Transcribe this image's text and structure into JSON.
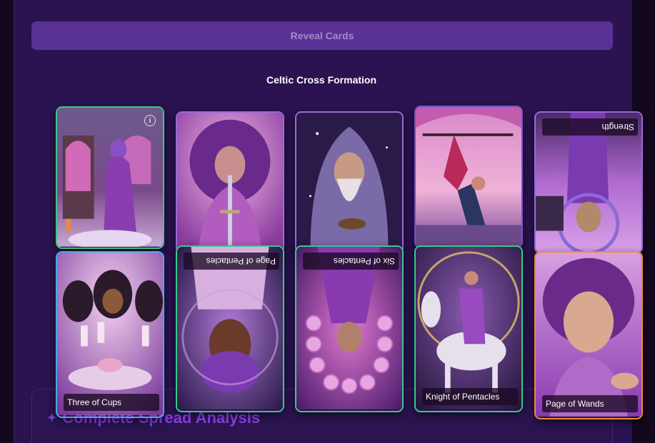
{
  "header": {
    "reveal_label": "Reveal Cards"
  },
  "formation": {
    "title": "Celtic Cross Formation"
  },
  "analysis": {
    "title": "Complete Spread Analysis"
  },
  "cards": [
    {
      "name": "",
      "reversed": false,
      "border": "#38c98a"
    },
    {
      "name": "",
      "reversed": false,
      "border": "#9b6ad6"
    },
    {
      "name": "",
      "reversed": false,
      "border": "#9b6ad6"
    },
    {
      "name": "",
      "reversed": false,
      "border": "#7a4fc2"
    },
    {
      "name": "Strength",
      "reversed": true,
      "border": "#9b6ad6"
    },
    {
      "name": "Three of Cups",
      "reversed": false,
      "border": "#4aa7e8"
    },
    {
      "name": "Page of Pentacles",
      "reversed": true,
      "border": "#38c98a"
    },
    {
      "name": "Six of Pentacles",
      "reversed": true,
      "border": "#38c98a"
    },
    {
      "name": "Knight of Pentacles",
      "reversed": false,
      "border": "#38c98a"
    },
    {
      "name": "Page of Wands",
      "reversed": false,
      "border": "#f08a35"
    }
  ]
}
